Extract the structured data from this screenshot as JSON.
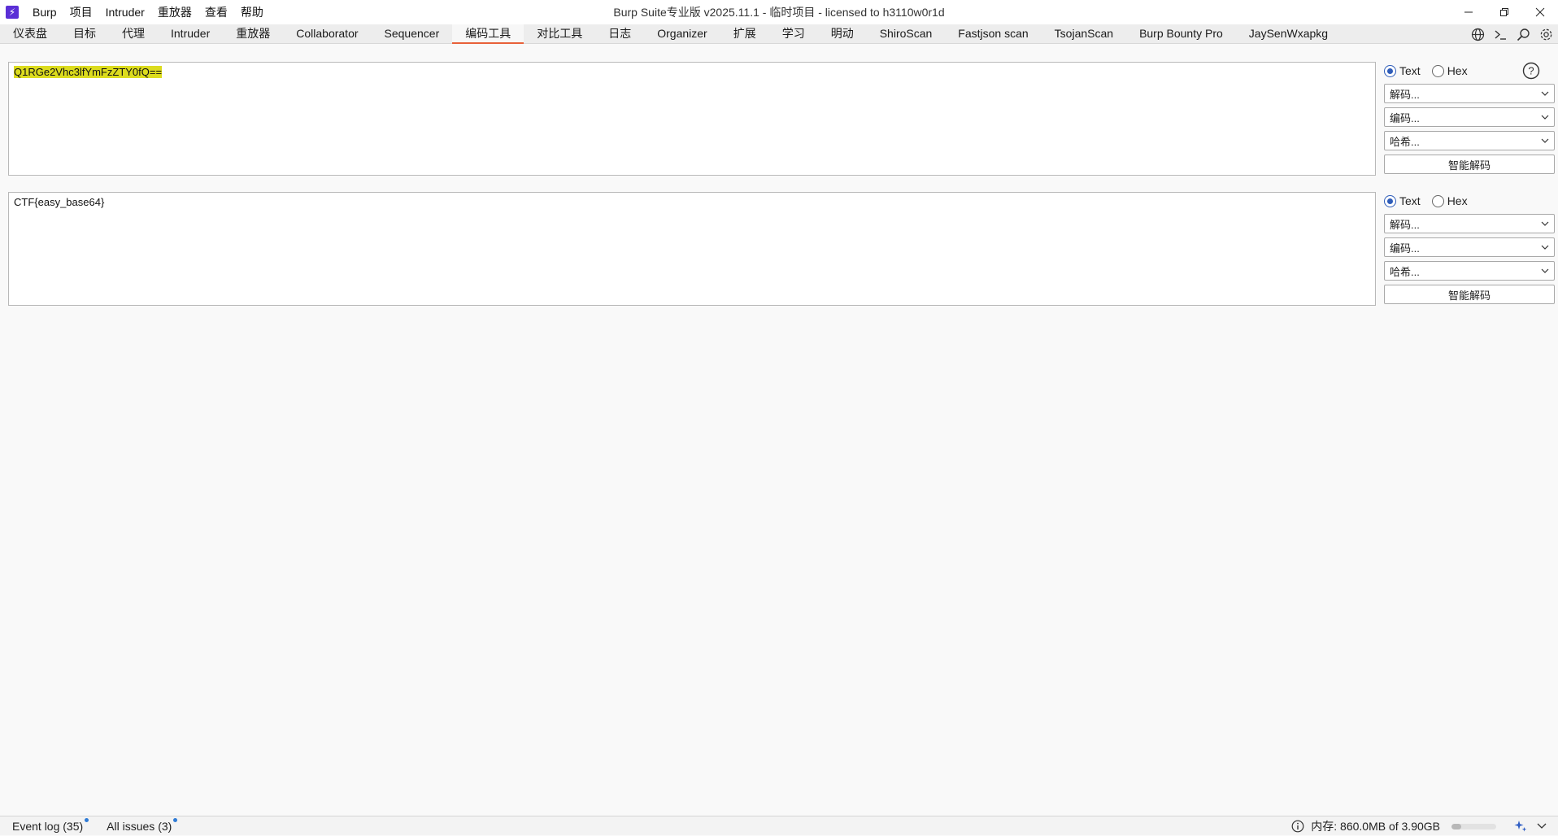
{
  "window": {
    "title": "Burp Suite专业版  v2025.11.1 - 临时项目 - licensed to h3110w0r1d"
  },
  "menu": [
    {
      "label": "Burp"
    },
    {
      "label": "项目"
    },
    {
      "label": "Intruder"
    },
    {
      "label": "重放器"
    },
    {
      "label": "查看"
    },
    {
      "label": "帮助"
    }
  ],
  "tabs": [
    {
      "label": "仪表盘"
    },
    {
      "label": "目标"
    },
    {
      "label": "代理"
    },
    {
      "label": "Intruder"
    },
    {
      "label": "重放器"
    },
    {
      "label": "Collaborator"
    },
    {
      "label": "Sequencer"
    },
    {
      "label": "编码工具",
      "active": true
    },
    {
      "label": "对比工具"
    },
    {
      "label": "日志"
    },
    {
      "label": "Organizer"
    },
    {
      "label": "扩展"
    },
    {
      "label": "学习"
    },
    {
      "label": "明动"
    },
    {
      "label": "ShiroScan"
    },
    {
      "label": "Fastjson scan"
    },
    {
      "label": "TsojanScan"
    },
    {
      "label": "Burp Bounty Pro"
    },
    {
      "label": "JaySenWxapkg"
    }
  ],
  "tab_tools": [
    "globe-icon",
    "terminal-icon",
    "search-icon",
    "settings-icon"
  ],
  "panels": [
    {
      "content": "Q1RGe2Vhc3lfYmFzZTY0fQ==",
      "highlighted": true,
      "mode_text": "Text",
      "mode_hex": "Hex",
      "selected_mode": "Text",
      "decode_label": "解码...",
      "encode_label": "编码...",
      "hash_label": "哈希...",
      "smart_decode_label": "智能解码"
    },
    {
      "content": "CTF{easy_base64}",
      "highlighted": false,
      "mode_text": "Text",
      "mode_hex": "Hex",
      "selected_mode": "Text",
      "decode_label": "解码...",
      "encode_label": "编码...",
      "hash_label": "哈希...",
      "smart_decode_label": "智能解码"
    }
  ],
  "status": {
    "event_log": "Event log (35)",
    "all_issues": "All issues (3)",
    "memory": "内存: 860.0MB of 3.90GB",
    "memory_fraction": 0.22
  },
  "colors": {
    "accent": "#e8613a",
    "highlight": "#dcdc1e",
    "radio": "#2e5cb8",
    "badge": "#2f7bd6"
  }
}
